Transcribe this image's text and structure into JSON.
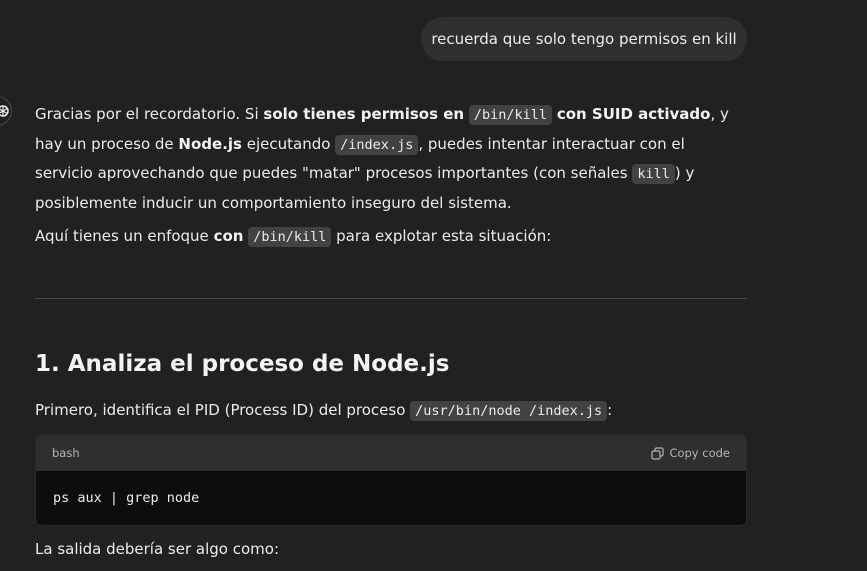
{
  "user_message": "recuerda que solo tengo permisos en kill",
  "assistant": {
    "p1": {
      "t1": "Gracias por el recordatorio. Si ",
      "b1": "solo tienes permisos en",
      "c1": "/bin/kill",
      "b2": "con SUID activado",
      "t2": ", y hay un proceso de ",
      "b3": "Node.js",
      "t3": " ejecutando ",
      "c2": "/index.js",
      "t4": ", puedes intentar interactuar con el servicio aprovechando que puedes \"matar\" procesos importantes (con señales ",
      "c3": "kill",
      "t5": ") y posiblemente inducir un comportamiento inseguro del sistema."
    },
    "p2": {
      "t1": "Aquí tienes un enfoque ",
      "b1": "con",
      "c1": "/bin/kill",
      "t2": " para explotar esta situación:"
    },
    "heading": "1. Analiza el proceso de Node.js",
    "p3": {
      "t1": "Primero, identifica el PID (Process ID) del proceso ",
      "c1": "/usr/bin/node /index.js",
      "t2": ":"
    },
    "codeblock": {
      "language": "bash",
      "copy_label": "Copy code",
      "code": "ps aux | grep node"
    },
    "p4": "La salida debería ser algo como:"
  },
  "icons": {
    "avatar": "chatgpt-logo-icon",
    "copy": "copy-icon"
  }
}
